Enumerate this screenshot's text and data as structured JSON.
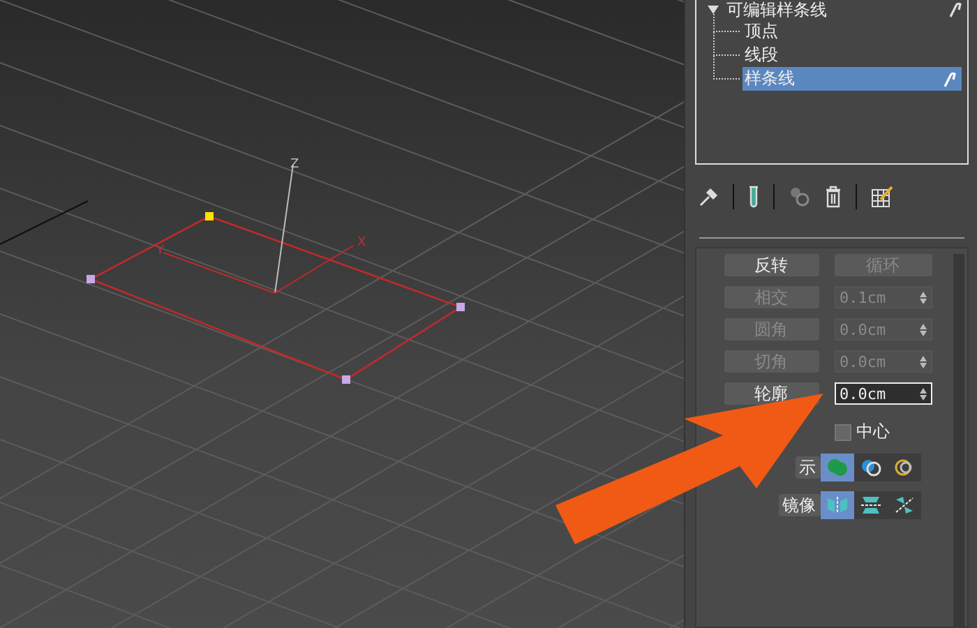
{
  "viewport": {
    "axis_labels": [
      "Z",
      "X",
      "Y"
    ]
  },
  "tree": {
    "title": "可编辑样条线",
    "expanded": true,
    "items": [
      {
        "label": "顶点",
        "selected": false
      },
      {
        "label": "线段",
        "selected": false
      },
      {
        "label": "样条线",
        "selected": true
      }
    ]
  },
  "geometry_rows": [
    {
      "button": "反转",
      "button_disabled": false,
      "kind": "button",
      "right": "循环",
      "right_disabled": true
    },
    {
      "button": "相交",
      "button_disabled": true,
      "kind": "spinner",
      "right": "0.1cm",
      "right_disabled": true,
      "focused": false
    },
    {
      "button": "圆角",
      "button_disabled": true,
      "kind": "spinner",
      "right": "0.0cm",
      "right_disabled": true,
      "focused": false
    },
    {
      "button": "切角",
      "button_disabled": true,
      "kind": "spinner",
      "right": "0.0cm",
      "right_disabled": true,
      "focused": false
    },
    {
      "button": "轮廓",
      "button_disabled": false,
      "kind": "spinner",
      "right": "0.0cm",
      "right_disabled": false,
      "focused": true
    }
  ],
  "center_checkbox": {
    "label": "中心",
    "checked": false
  },
  "icon_rows": [
    {
      "label": "示",
      "icons": [
        {
          "kind": "union",
          "selected": true
        },
        {
          "kind": "subtract",
          "selected": false
        },
        {
          "kind": "intersect",
          "selected": false
        }
      ]
    },
    {
      "label": "镜像",
      "icons": [
        {
          "kind": "mirror-h",
          "selected": true
        },
        {
          "kind": "mirror-v",
          "selected": false
        },
        {
          "kind": "mirror-d",
          "selected": false
        }
      ]
    }
  ]
}
